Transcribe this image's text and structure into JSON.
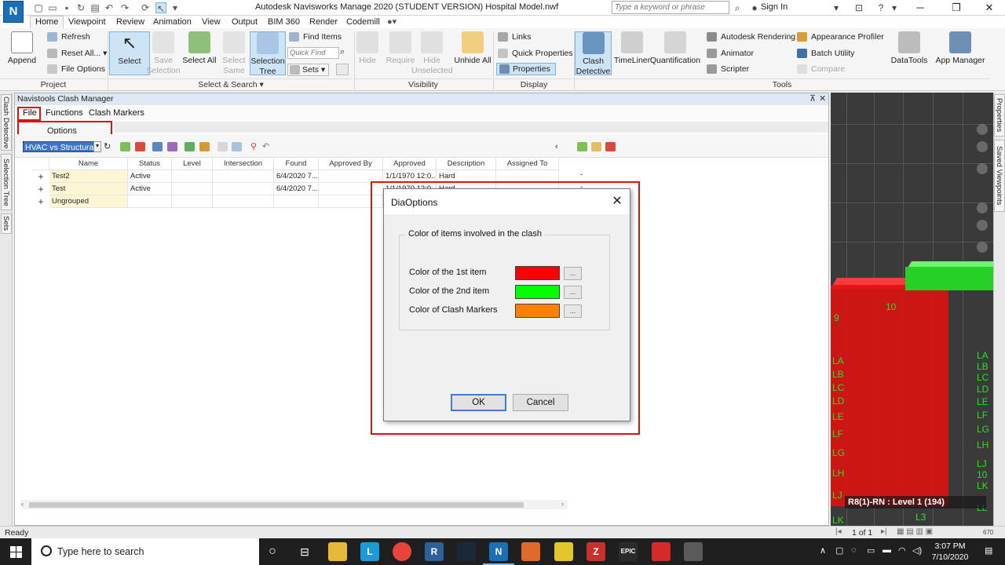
{
  "window": {
    "title": "Autodesk Navisworks Manage 2020 (STUDENT VERSION)     Hospital Model.nwf",
    "app_logo": "N",
    "search_placeholder": "Type a keyword or phrase",
    "sign_in": "Sign In"
  },
  "tabs": [
    "Home",
    "Viewpoint",
    "Review",
    "Animation",
    "View",
    "Output",
    "BIM 360",
    "Render",
    "Codemill"
  ],
  "ribbon": {
    "append": "Append",
    "refresh": "Refresh",
    "reset_all": "Reset All...",
    "file_options": "File Options",
    "select": "Select",
    "save_selection": "Save Selection",
    "select_all": "Select All",
    "select_same": "Select Same",
    "selection_tree": "Selection Tree",
    "find_items": "Find Items",
    "quick_find_placeholder": "Quick Find",
    "sets": "Sets",
    "hide": "Hide",
    "require": "Require",
    "hide_unselected": "Hide Unselected",
    "unhide_all": "Unhide All",
    "links": "Links",
    "quick_properties": "Quick Properties",
    "properties": "Properties",
    "clash_detective": "Clash Detective",
    "timeliner": "TimeLiner",
    "quantification": "Quantification",
    "autodesk_rendering": "Autodesk Rendering",
    "animator": "Animator",
    "scripter": "Scripter",
    "appearance_profiler": "Appearance Profiler",
    "batch_utility": "Batch Utility",
    "compare": "Compare",
    "datatools": "DataTools",
    "app_manager": "App Manager",
    "groups": {
      "project": "Project",
      "select_search": "Select & Search",
      "visibility": "Visibility",
      "display": "Display",
      "tools": "Tools"
    }
  },
  "side_tabs": {
    "left": [
      "Clash Detective",
      "Selection Tree",
      "Sets"
    ],
    "right": [
      "Properties",
      "Saved Viewpoints"
    ]
  },
  "clash_manager": {
    "title": "Navistools Clash Manager",
    "menu": [
      "File",
      "Functions",
      "Clash Markers"
    ],
    "dropdown_item": "Options",
    "test_selected": "HVAC vs Structural",
    "columns": [
      "Name",
      "Status",
      "Level",
      "Intersection",
      "Found",
      "Approved By",
      "Approved",
      "Description",
      "Assigned To"
    ],
    "rows": [
      {
        "name": "Test2",
        "status": "Active",
        "level": "",
        "intersection": "",
        "found": "6/4/2020 7...",
        "approved_by": "",
        "approved": "1/1/1970 12:0...",
        "description": "Hard",
        "assigned_to": "",
        "trailing": "-"
      },
      {
        "name": "Test",
        "status": "Active",
        "level": "",
        "intersection": "",
        "found": "6/4/2020 7...",
        "approved_by": "",
        "approved": "1/1/1970 12:0...",
        "description": "Hard",
        "assigned_to": "",
        "trailing": "-"
      },
      {
        "name": "Ungrouped",
        "status": "",
        "level": "",
        "intersection": "",
        "found": "",
        "approved_by": "",
        "approved": "",
        "description": "",
        "assigned_to": "",
        "trailing": ""
      }
    ]
  },
  "dialog": {
    "title": "DiaOptions",
    "group_label": "Color of items involved in the clash",
    "items": [
      {
        "label": "Color of the 1st item",
        "color": "#ff0000"
      },
      {
        "label": "Color of the 2nd item",
        "color": "#00ff00"
      },
      {
        "label": "Color of Clash Markers",
        "color": "#ff8000"
      }
    ],
    "pick_label": "...",
    "ok": "OK",
    "cancel": "Cancel"
  },
  "viewport": {
    "caption": "R8(1)-RN : Level 1 (194)",
    "labels_left": [
      "9",
      "LA",
      "LB",
      "LC",
      "LD",
      "LE",
      "LF",
      "LG",
      "LH",
      "LJ",
      "LK"
    ],
    "labels_right": [
      "LA",
      "LB",
      "LC",
      "LD",
      "LE",
      "LF",
      "LG",
      "LH",
      "LJ",
      "10",
      "LK",
      "LL"
    ],
    "label_mid": "10",
    "label_bottom": "L3"
  },
  "status": {
    "text": "Ready",
    "page": "1 of 1",
    "zoom": "670"
  },
  "taskbar": {
    "search": "Type here to search",
    "time": "3:07 PM",
    "date": "7/10/2020"
  }
}
